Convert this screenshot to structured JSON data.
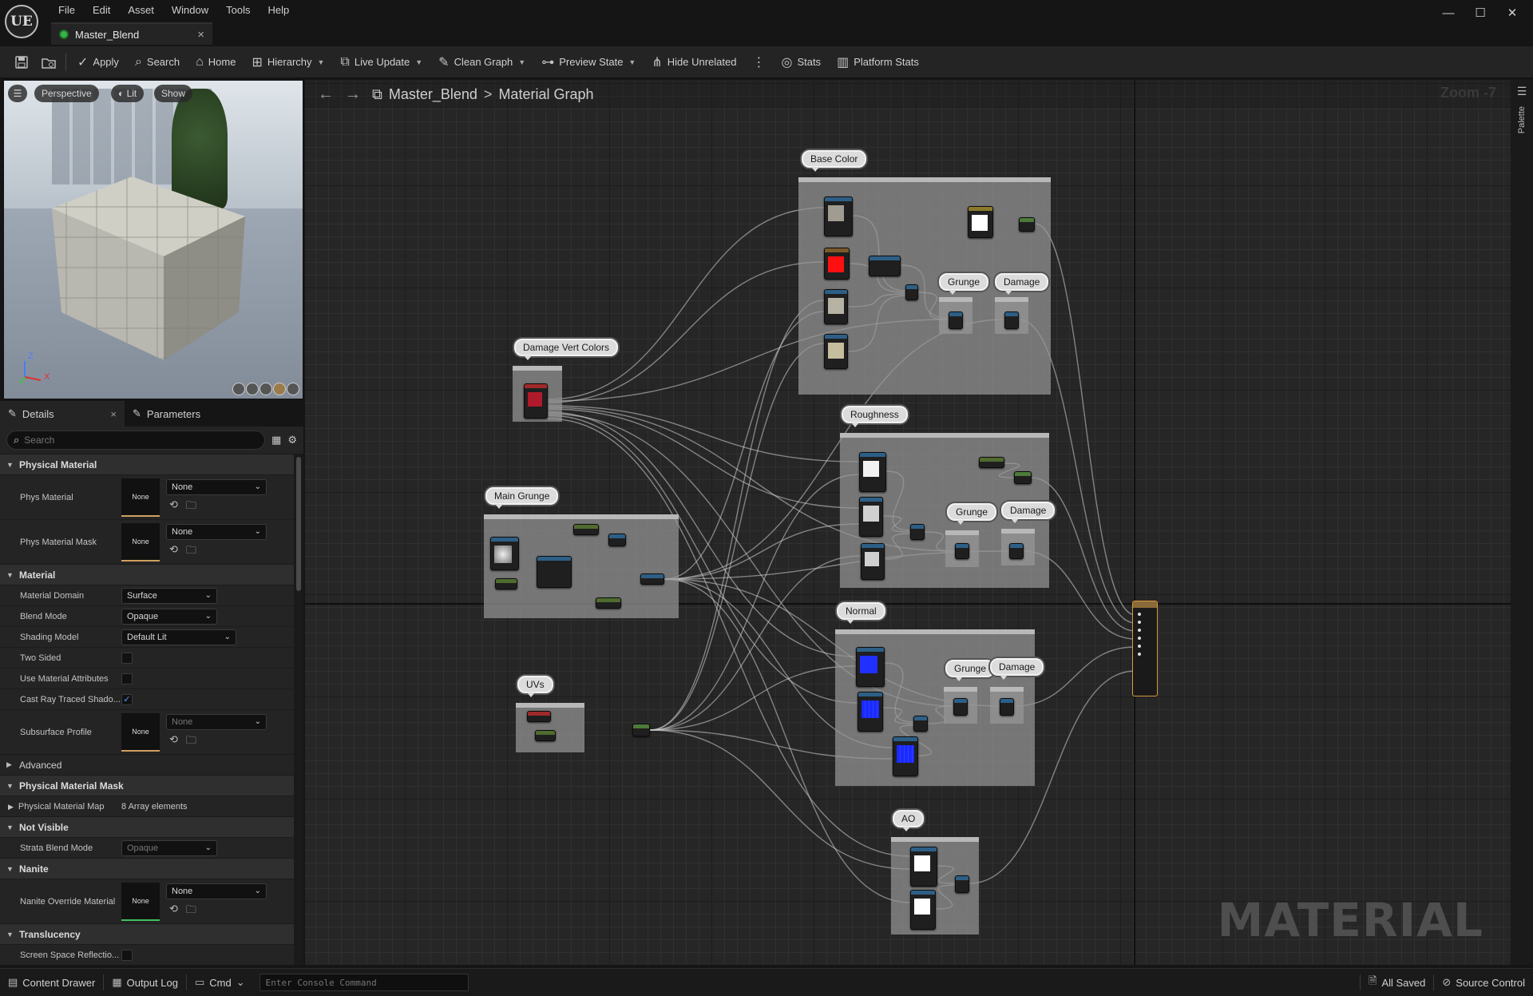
{
  "app": {
    "logo": "UE",
    "menu": [
      "File",
      "Edit",
      "Asset",
      "Window",
      "Tools",
      "Help"
    ],
    "document_tab": "Master_Blend",
    "window_controls": {
      "minimize": "—",
      "maximize": "☐",
      "close": "✕"
    }
  },
  "toolbar": {
    "save_icon": "save-icon",
    "browse_icon": "browse-icon",
    "apply": "Apply",
    "search": "Search",
    "home": "Home",
    "hierarchy": "Hierarchy",
    "live_update": "Live Update",
    "clean_graph": "Clean Graph",
    "preview_state": "Preview State",
    "hide_unrelated": "Hide Unrelated",
    "stats": "Stats",
    "platform_stats": "Platform Stats"
  },
  "viewport": {
    "perspective": "Perspective",
    "lit": "Lit",
    "show": "Show",
    "axis_z": "Z",
    "axis_x": "X"
  },
  "details": {
    "tab_details": "Details",
    "tab_parameters": "Parameters",
    "search_placeholder": "Search",
    "sections": {
      "physical_material": {
        "title": "Physical Material",
        "phys_material": {
          "label": "Phys Material",
          "thumb": "None",
          "value": "None"
        },
        "phys_material_mask": {
          "label": "Phys Material Mask",
          "thumb": "None",
          "value": "None"
        }
      },
      "material": {
        "title": "Material",
        "domain": {
          "label": "Material Domain",
          "value": "Surface"
        },
        "blend": {
          "label": "Blend Mode",
          "value": "Opaque"
        },
        "shading": {
          "label": "Shading Model",
          "value": "Default Lit"
        },
        "two_sided": {
          "label": "Two Sided",
          "checked": false
        },
        "use_attrs": {
          "label": "Use Material Attributes",
          "checked": false
        },
        "cast_ray": {
          "label": "Cast Ray Traced Shado...",
          "checked": true
        },
        "subsurface": {
          "label": "Subsurface Profile",
          "thumb": "None",
          "value": "None"
        }
      },
      "advanced": {
        "title": "Advanced"
      },
      "phys_mask": {
        "title": "Physical Material Mask",
        "map": {
          "label": "Physical Material Map",
          "value": "8 Array elements"
        }
      },
      "not_visible": {
        "title": "Not Visible",
        "strata": {
          "label": "Strata Blend Mode",
          "value": "Opaque"
        }
      },
      "nanite": {
        "title": "Nanite",
        "override": {
          "label": "Nanite Override Material",
          "thumb": "None",
          "value": "None"
        }
      },
      "translucency": {
        "title": "Translucency",
        "ssr": {
          "label": "Screen Space Reflectio..."
        }
      }
    }
  },
  "graph": {
    "breadcrumb": [
      "Master_Blend",
      "Material Graph"
    ],
    "separator": ">",
    "zoom": "Zoom -7",
    "watermark": "MATERIAL",
    "palette_label": "Palette",
    "comments": {
      "base_color": "Base Color",
      "damage_vert": "Damage Vert Colors",
      "main_grunge": "Main Grunge",
      "roughness": "Roughness",
      "normal": "Normal",
      "uvs": "UVs",
      "ao": "AO",
      "grunge": "Grunge",
      "damage": "Damage"
    },
    "colors": {
      "texture_header": "#2d5f86",
      "param_header": "#4f6b2f",
      "output_border": "#d89c3a",
      "wire": "#cfcfcf"
    }
  },
  "statusbar": {
    "content_drawer": "Content Drawer",
    "output_log": "Output Log",
    "cmd": "Cmd",
    "console_placeholder": "Enter Console Command",
    "all_saved": "All Saved",
    "source_control": "Source Control"
  }
}
